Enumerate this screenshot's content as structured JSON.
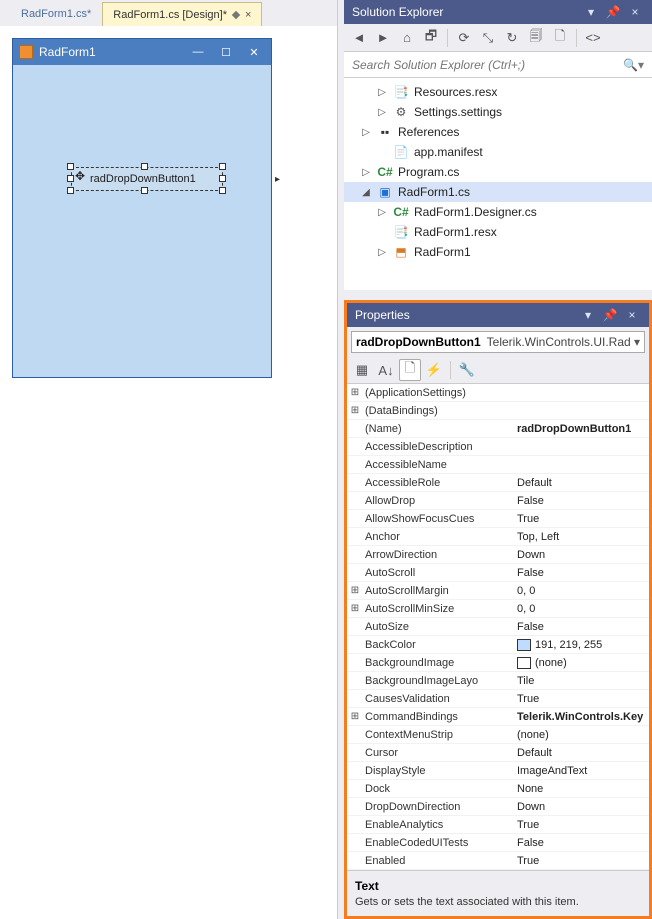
{
  "tabs": [
    {
      "label": "RadForm1.cs*",
      "active": false
    },
    {
      "label": "RadForm1.cs [Design]*",
      "active": true
    }
  ],
  "designer": {
    "form_title": "RadForm1",
    "control_text": "radDropDownButton1"
  },
  "solution_explorer": {
    "title": "Solution Explorer",
    "search_placeholder": "Search Solution Explorer (Ctrl+;)",
    "items": [
      {
        "indent": 28,
        "exp": "▷",
        "icon": "resx",
        "label": "Resources.resx"
      },
      {
        "indent": 28,
        "exp": "▷",
        "icon": "set",
        "label": "Settings.settings"
      },
      {
        "indent": 12,
        "exp": "▷",
        "icon": "ref",
        "label": "References"
      },
      {
        "indent": 28,
        "exp": "",
        "icon": "manifest",
        "label": "app.manifest"
      },
      {
        "indent": 12,
        "exp": "▷",
        "icon": "cs",
        "label": "Program.cs"
      },
      {
        "indent": 12,
        "exp": "◢",
        "icon": "form",
        "label": "RadForm1.cs",
        "sel": true
      },
      {
        "indent": 28,
        "exp": "▷",
        "icon": "cs",
        "label": "RadForm1.Designer.cs"
      },
      {
        "indent": 28,
        "exp": "",
        "icon": "resx",
        "label": "RadForm1.resx"
      },
      {
        "indent": 28,
        "exp": "▷",
        "icon": "partial",
        "label": "RadForm1"
      }
    ]
  },
  "properties": {
    "title": "Properties",
    "object_name": "radDropDownButton1",
    "object_type": "Telerik.WinControls.UI.Rad",
    "desc_title": "Text",
    "desc_body": "Gets or sets the text associated with this item.",
    "rows": [
      {
        "exp": "⊞",
        "name": "(ApplicationSettings)",
        "val": ""
      },
      {
        "exp": "⊞",
        "name": "(DataBindings)",
        "val": ""
      },
      {
        "exp": "",
        "name": "(Name)",
        "val": "radDropDownButton1",
        "bold": true
      },
      {
        "exp": "",
        "name": "AccessibleDescription",
        "val": ""
      },
      {
        "exp": "",
        "name": "AccessibleName",
        "val": ""
      },
      {
        "exp": "",
        "name": "AccessibleRole",
        "val": "Default"
      },
      {
        "exp": "",
        "name": "AllowDrop",
        "val": "False"
      },
      {
        "exp": "",
        "name": "AllowShowFocusCues",
        "val": "True"
      },
      {
        "exp": "",
        "name": "Anchor",
        "val": "Top, Left"
      },
      {
        "exp": "",
        "name": "ArrowDirection",
        "val": "Down"
      },
      {
        "exp": "",
        "name": "AutoScroll",
        "val": "False"
      },
      {
        "exp": "⊞",
        "name": "AutoScrollMargin",
        "val": "0, 0"
      },
      {
        "exp": "⊞",
        "name": "AutoScrollMinSize",
        "val": "0, 0"
      },
      {
        "exp": "",
        "name": "AutoSize",
        "val": "False"
      },
      {
        "exp": "",
        "name": "BackColor",
        "val": "191, 219, 255",
        "swatch": "#bfdbff"
      },
      {
        "exp": "",
        "name": "BackgroundImage",
        "val": "(none)",
        "swatch": "#ffffff"
      },
      {
        "exp": "",
        "name": "BackgroundImageLayo",
        "val": "Tile"
      },
      {
        "exp": "",
        "name": "CausesValidation",
        "val": "True"
      },
      {
        "exp": "⊞",
        "name": "CommandBindings",
        "val": "Telerik.WinControls.Key",
        "bold": true
      },
      {
        "exp": "",
        "name": "ContextMenuStrip",
        "val": "(none)"
      },
      {
        "exp": "",
        "name": "Cursor",
        "val": "Default"
      },
      {
        "exp": "",
        "name": "DisplayStyle",
        "val": "ImageAndText"
      },
      {
        "exp": "",
        "name": "Dock",
        "val": "None"
      },
      {
        "exp": "",
        "name": "DropDownDirection",
        "val": "Down"
      },
      {
        "exp": "",
        "name": "EnableAnalytics",
        "val": "True"
      },
      {
        "exp": "",
        "name": "EnableCodedUITests",
        "val": "False"
      },
      {
        "exp": "",
        "name": "Enabled",
        "val": "True"
      }
    ]
  }
}
